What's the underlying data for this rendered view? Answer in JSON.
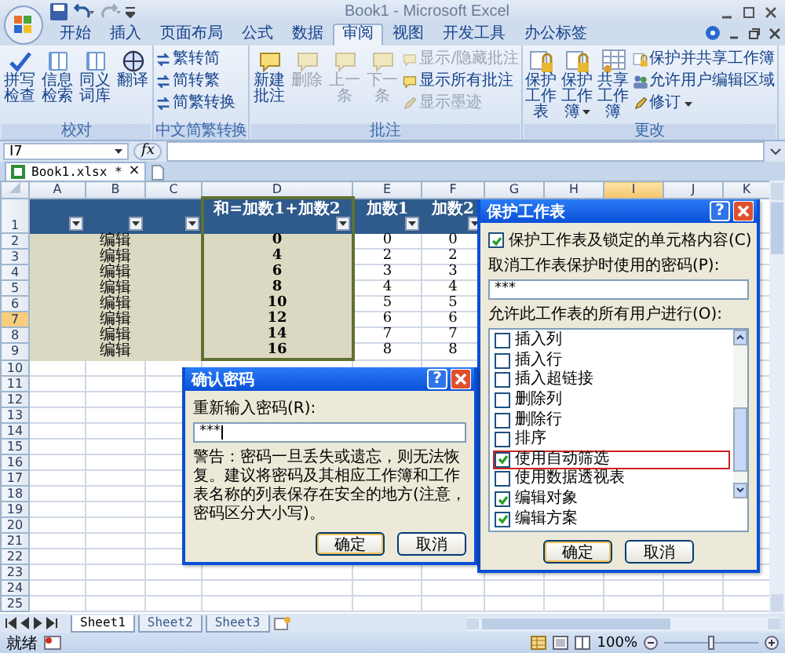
{
  "window": {
    "title": "Book1 - Microsoft Excel"
  },
  "ribbon_tabs": [
    {
      "label": "开始",
      "selected": false
    },
    {
      "label": "插入",
      "selected": false
    },
    {
      "label": "页面布局",
      "selected": false
    },
    {
      "label": "公式",
      "selected": false
    },
    {
      "label": "数据",
      "selected": false
    },
    {
      "label": "审阅",
      "selected": true
    },
    {
      "label": "视图",
      "selected": false
    },
    {
      "label": "开发工具",
      "selected": false
    },
    {
      "label": "办公标签",
      "selected": false
    }
  ],
  "ribbon_groups": [
    {
      "label": "校对",
      "items": [
        {
          "kind": "large",
          "label": "拼写检查",
          "disabled": false,
          "dropdown": false
        },
        {
          "kind": "large",
          "label": "信息检索",
          "disabled": false,
          "dropdown": false
        },
        {
          "kind": "large",
          "label": "同义词库",
          "disabled": false,
          "dropdown": false
        },
        {
          "kind": "large",
          "label": "翻译",
          "disabled": false,
          "dropdown": false
        }
      ]
    },
    {
      "label": "中文简繁转换",
      "items": [
        {
          "kind": "small",
          "label": "繁转简",
          "disabled": false,
          "dropdown": false
        },
        {
          "kind": "small",
          "label": "简转繁",
          "disabled": false,
          "dropdown": false
        },
        {
          "kind": "small",
          "label": "简繁转换",
          "disabled": false,
          "dropdown": false
        }
      ]
    },
    {
      "label": "批注",
      "items": [
        {
          "kind": "large",
          "label": "新建批注",
          "disabled": false,
          "dropdown": false
        },
        {
          "kind": "large",
          "label": "删除",
          "disabled": true,
          "dropdown": false
        },
        {
          "kind": "large",
          "label": "上一条",
          "disabled": true,
          "dropdown": false
        },
        {
          "kind": "large",
          "label": "下一条",
          "disabled": true,
          "dropdown": false
        },
        {
          "kind": "small",
          "label": "显示/隐藏批注",
          "disabled": true,
          "dropdown": false
        },
        {
          "kind": "small",
          "label": "显示所有批注",
          "disabled": false,
          "dropdown": false
        },
        {
          "kind": "small",
          "label": "显示墨迹",
          "disabled": true,
          "dropdown": false
        }
      ]
    },
    {
      "label": "更改",
      "items": [
        {
          "kind": "large",
          "label": "保护工作表",
          "disabled": false,
          "dropdown": false
        },
        {
          "kind": "large",
          "label": "保护工作簿",
          "disabled": false,
          "dropdown": true
        },
        {
          "kind": "large",
          "label": "共享工作簿",
          "disabled": false,
          "dropdown": false
        },
        {
          "kind": "small",
          "label": "保护并共享工作簿",
          "disabled": false,
          "dropdown": false
        },
        {
          "kind": "small",
          "label": "允许用户编辑区域",
          "disabled": false,
          "dropdown": false
        },
        {
          "kind": "small",
          "label": "修订",
          "disabled": false,
          "dropdown": true
        }
      ]
    }
  ],
  "formula_bar": {
    "name_box": "I7",
    "function_label": "fx"
  },
  "workbook_tab": {
    "label": "Book1.xlsx *",
    "close": "×"
  },
  "columns": [
    {
      "label": "A",
      "selected": false
    },
    {
      "label": "B",
      "selected": false
    },
    {
      "label": "C",
      "selected": false
    },
    {
      "label": "D",
      "selected": false
    },
    {
      "label": "E",
      "selected": false
    },
    {
      "label": "F",
      "selected": false
    },
    {
      "label": "G",
      "selected": false
    },
    {
      "label": "H",
      "selected": false
    },
    {
      "label": "I",
      "selected": true
    },
    {
      "label": "J",
      "selected": false
    },
    {
      "label": "K",
      "selected": false
    }
  ],
  "header_row": {
    "number": "1",
    "cells": [
      {
        "filter": true
      },
      {
        "filter": true
      },
      {
        "filter": true
      },
      {
        "text": "和=加数1+加数2",
        "filter": true
      },
      {
        "text": "加数1",
        "filter": true
      },
      {
        "text": "加数2",
        "filter": true
      }
    ]
  },
  "rows": [
    {
      "number": "2",
      "selected": false,
      "merged": "编辑",
      "sum": "0",
      "addend1": "0",
      "addend2": "0"
    },
    {
      "number": "3",
      "selected": false,
      "merged": "编辑",
      "sum": "4",
      "addend1": "2",
      "addend2": "2"
    },
    {
      "number": "4",
      "selected": false,
      "merged": "编辑",
      "sum": "6",
      "addend1": "3",
      "addend2": "3"
    },
    {
      "number": "5",
      "selected": false,
      "merged": "编辑",
      "sum": "8",
      "addend1": "4",
      "addend2": "4"
    },
    {
      "number": "6",
      "selected": false,
      "merged": "编辑",
      "sum": "10",
      "addend1": "5",
      "addend2": "5"
    },
    {
      "number": "7",
      "selected": true,
      "merged": "编辑",
      "sum": "12",
      "addend1": "6",
      "addend2": "6"
    },
    {
      "number": "8",
      "selected": false,
      "merged": "编辑",
      "sum": "14",
      "addend1": "7",
      "addend2": "7"
    },
    {
      "number": "9",
      "selected": false,
      "merged": "编辑",
      "sum": "16",
      "addend1": "8",
      "addend2": "8"
    },
    {
      "number": "10",
      "selected": false
    },
    {
      "number": "11",
      "selected": false
    },
    {
      "number": "12",
      "selected": false
    },
    {
      "number": "13",
      "selected": false
    },
    {
      "number": "14",
      "selected": false
    },
    {
      "number": "15",
      "selected": false
    },
    {
      "number": "16",
      "selected": false
    },
    {
      "number": "17",
      "selected": false
    },
    {
      "number": "18",
      "selected": false
    },
    {
      "number": "19",
      "selected": false
    },
    {
      "number": "20",
      "selected": false
    },
    {
      "number": "21",
      "selected": false
    },
    {
      "number": "22",
      "selected": false
    },
    {
      "number": "23",
      "selected": false
    },
    {
      "number": "24",
      "selected": false
    },
    {
      "number": "25",
      "selected": false
    }
  ],
  "protect_dialog": {
    "title": "保护工作表",
    "help": "?",
    "protect_checkbox": {
      "label": "保护工作表及锁定的单元格内容(C)",
      "checked": true
    },
    "password_label": "取消工作表保护时使用的密码(P):",
    "password_value": "***",
    "permissions_label": "允许此工作表的所有用户进行(O):",
    "permissions": [
      {
        "label": "插入列",
        "checked": false,
        "highlighted": false
      },
      {
        "label": "插入行",
        "checked": false,
        "highlighted": false
      },
      {
        "label": "插入超链接",
        "checked": false,
        "highlighted": false
      },
      {
        "label": "删除列",
        "checked": false,
        "highlighted": false
      },
      {
        "label": "删除行",
        "checked": false,
        "highlighted": false
      },
      {
        "label": "排序",
        "checked": false,
        "highlighted": false
      },
      {
        "label": "使用自动筛选",
        "checked": true,
        "highlighted": true
      },
      {
        "label": "使用数据透视表",
        "checked": false,
        "highlighted": false
      },
      {
        "label": "编辑对象",
        "checked": true,
        "highlighted": false
      },
      {
        "label": "编辑方案",
        "checked": true,
        "highlighted": false
      }
    ],
    "buttons": [
      "确定",
      "取消"
    ]
  },
  "confirm_dialog": {
    "title": "确认密码",
    "help": "?",
    "label": "重新输入密码(R):",
    "value": "***",
    "warning": "警告：密码一旦丢失或遗忘，则无法恢复。建议将密码及其相应工作簿和工作表名称的列表保存在安全的地方(注意，密码区分大小写)。",
    "buttons": [
      "确定",
      "取消"
    ]
  },
  "sheet_tabs": [
    {
      "label": "Sheet1",
      "selected": true
    },
    {
      "label": "Sheet2",
      "selected": false
    },
    {
      "label": "Sheet3",
      "selected": false
    }
  ],
  "status_bar": {
    "text": "就绪",
    "zoom": "100%"
  },
  "zoom_slider": {
    "level": 0.5
  }
}
